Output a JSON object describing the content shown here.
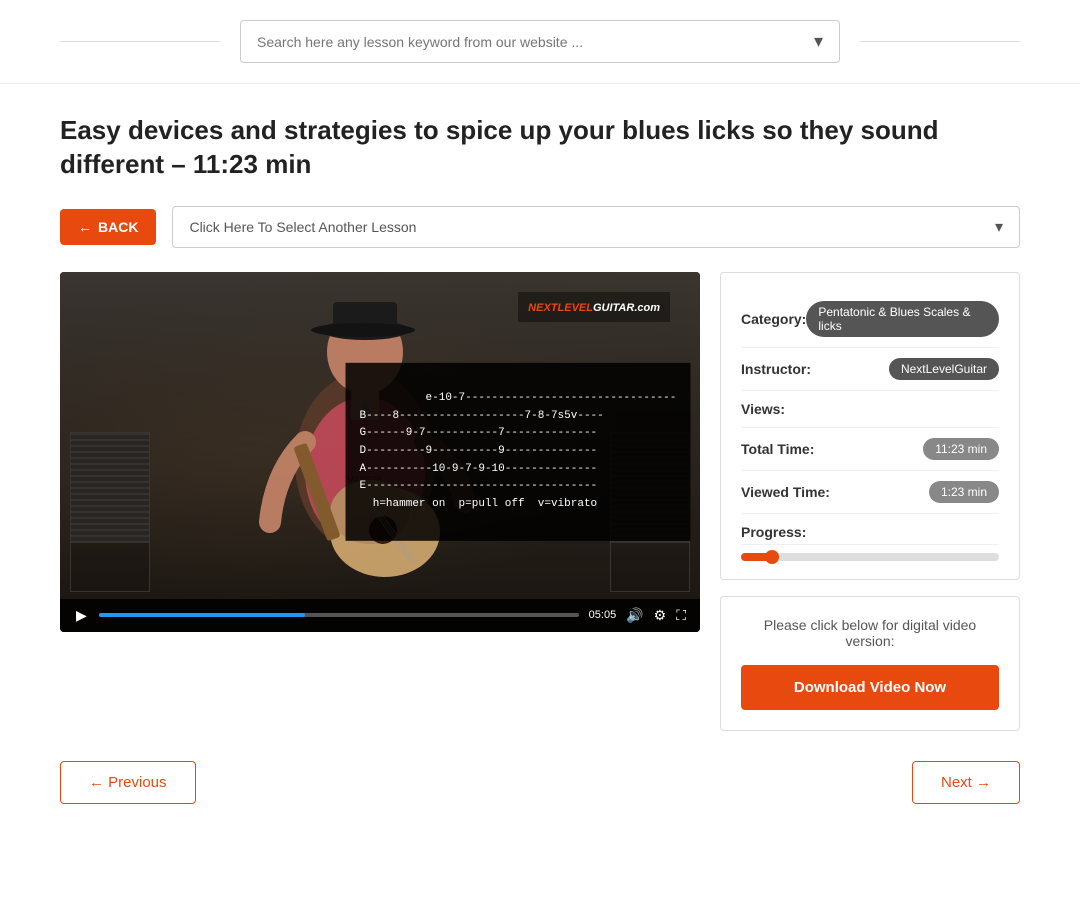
{
  "header": {
    "search_placeholder": "Search here any lesson keyword from our website ..."
  },
  "page": {
    "title": "Easy devices and strategies to spice up your blues licks so they sound different – 11:23 min",
    "back_label": "BACK",
    "lesson_select_placeholder": "Click Here To Select Another Lesson"
  },
  "video": {
    "time_display": "05:05",
    "tab_notation": "e-10-7--------------------------------\nB----8-------------------7-8-7s5v----\nG------9-7-----------7--------------\nD---------9----------9--------------\nA----------10-9-7-9-10--------------\nE-----------------------------------\n  h=hammer on  p=pull off  v=vibrato",
    "logo": "NEXTLEVELGUITAR.com"
  },
  "sidebar": {
    "category_label": "Category:",
    "category_value": "Pentatonic & Blues Scales & licks",
    "instructor_label": "Instructor:",
    "instructor_value": "NextLevelGuitar",
    "views_label": "Views:",
    "views_value": "",
    "total_time_label": "Total Time:",
    "total_time_value": "11:23 min",
    "viewed_time_label": "Viewed Time:",
    "viewed_time_value": "1:23 min",
    "progress_label": "Progress:",
    "progress_percent": 12,
    "download_prompt": "Please click below for digital video version:",
    "download_button": "Download Video Now"
  },
  "nav": {
    "previous_label": "← Previous",
    "next_label": "Next →"
  }
}
